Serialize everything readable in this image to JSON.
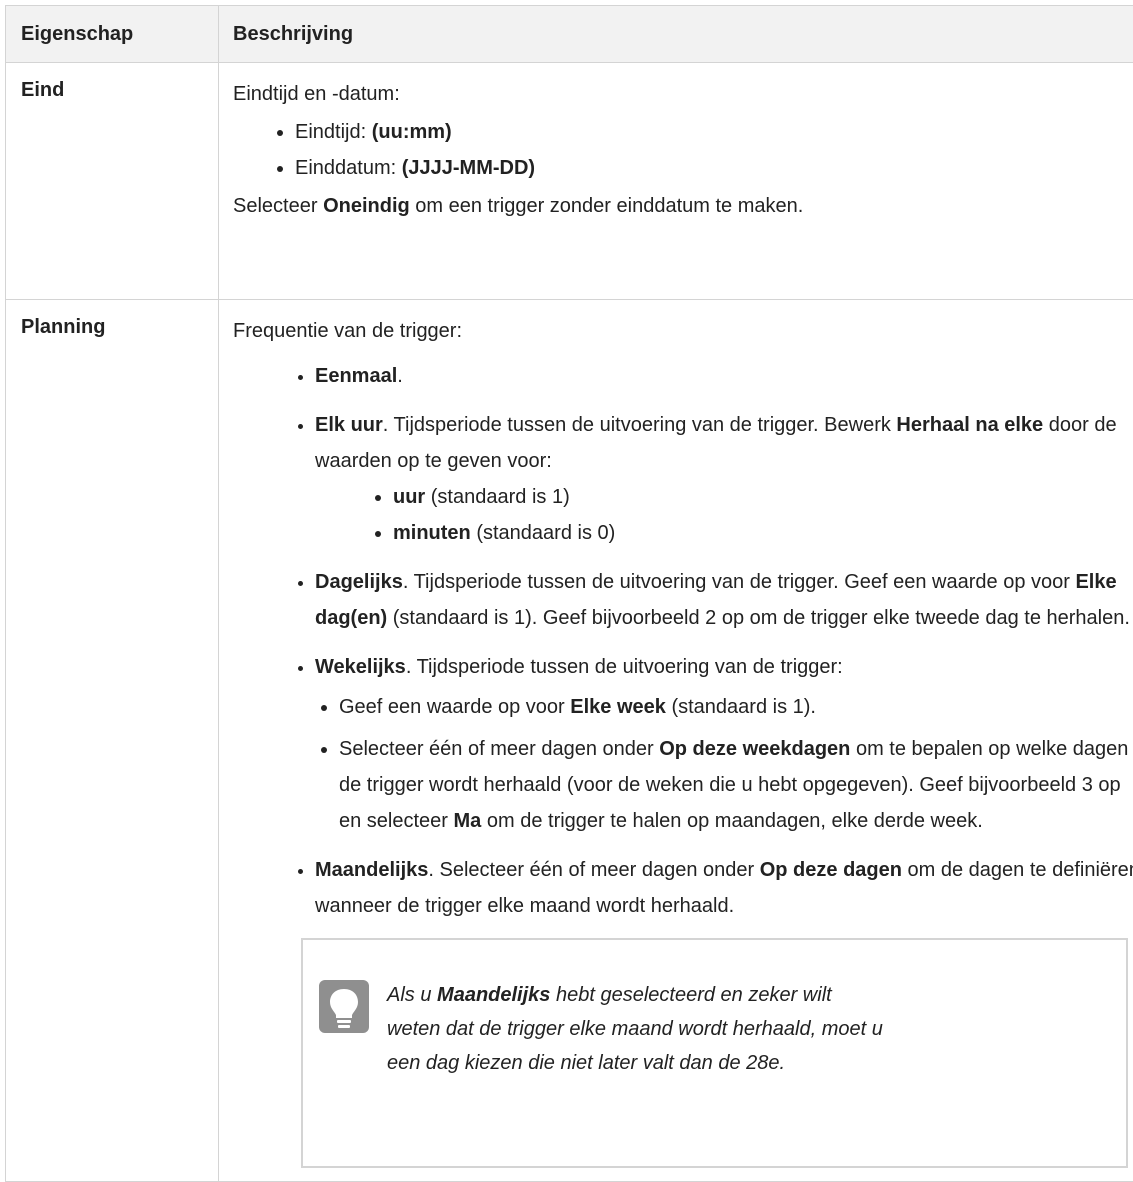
{
  "table": {
    "headers": {
      "property": "Eigenschap",
      "description": "Beschrijving"
    },
    "eind": {
      "name": "Eind",
      "intro": "Eindtijd en -datum:",
      "items": [
        {
          "label": "Eindtijd: ",
          "value": "(uu:mm)"
        },
        {
          "label": "Einddatum: ",
          "value": "(JJJJ-MM-DD)"
        }
      ],
      "outro_pre": "Selecteer ",
      "outro_bold": "Oneindig",
      "outro_post": " om een trigger zonder einddatum te maken."
    },
    "planning": {
      "name": "Planning",
      "intro": "Frequentie van de trigger:",
      "eenmaal": {
        "bold": "Eenmaal",
        "post": "."
      },
      "elk_uur": {
        "bold": "Elk uur",
        "text1": ". Tijdsperiode tussen de uitvoering van de trigger. Bewerk ",
        "bold2": "Herhaal na elke",
        "text2": " door de waarden op te geven voor:",
        "sub": [
          {
            "bold": "uur",
            "text": " (standaard is 1)"
          },
          {
            "bold": "minuten",
            "text": " (standaard is 0)"
          }
        ]
      },
      "dagelijks": {
        "bold": "Dagelijks",
        "text1": ". Tijdsperiode tussen de uitvoering van de trigger. Geef een waarde op voor ",
        "bold2": "Elke dag(en)",
        "text2": " (standaard is 1). Geef bijvoorbeeld 2 op om de trigger elke tweede dag te herhalen."
      },
      "wekelijks": {
        "bold": "Wekelijks",
        "text1": ". Tijdsperiode tussen de uitvoering van de trigger:",
        "sub1_pre": "Geef een waarde op voor ",
        "sub1_bold": "Elke week",
        "sub1_post": " (standaard is 1).",
        "sub2_pre": "Selecteer één of meer dagen onder ",
        "sub2_bold": "Op deze weekdagen",
        "sub2_mid": "  om te bepalen op welke dagen de trigger wordt herhaald (voor de weken die u hebt opgegeven). Geef bijvoorbeeld 3 op en selecteer ",
        "sub2_bold2": "Ma",
        "sub2_post": " om de trigger te halen op maandagen, elke derde week."
      },
      "maandelijks": {
        "bold": "Maandelijks",
        "text1": ". Selecteer één of meer dagen onder ",
        "bold2": "Op deze dagen",
        "text2": " om de dagen te definiëren wanneer de trigger elke maand wordt herhaald."
      },
      "tip": {
        "icon": "lightbulb-icon",
        "pre": "Als u ",
        "bold": "Maandelijks",
        "post": " hebt geselecteerd en zeker wilt weten dat de trigger elke maand wordt herhaald, moet u een dag kiezen die niet later valt dan de 28e."
      }
    }
  }
}
